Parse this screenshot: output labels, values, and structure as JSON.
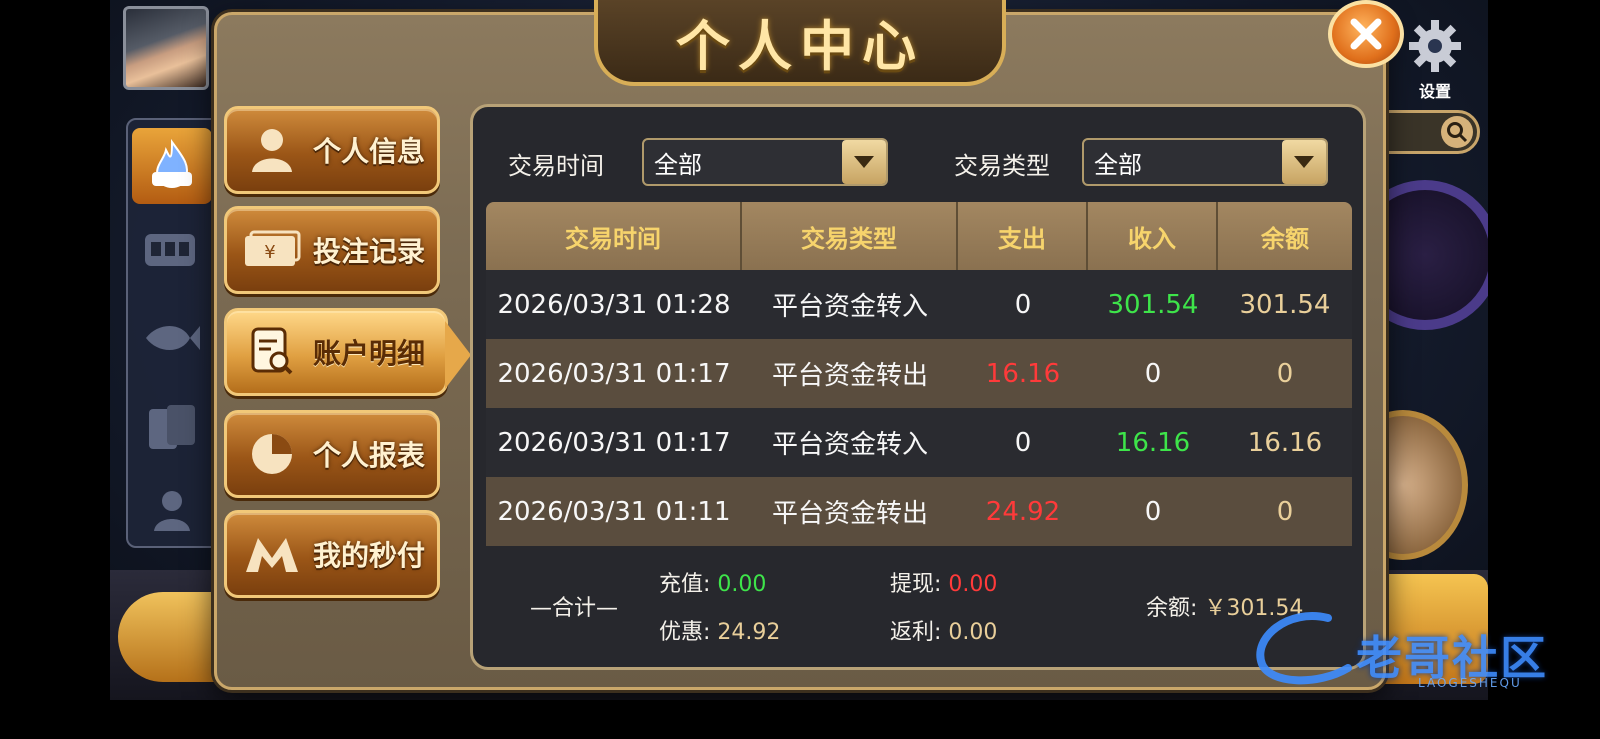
{
  "modal": {
    "title": "个人中心"
  },
  "settings": {
    "label": "设置"
  },
  "nav": [
    {
      "label": "个人信息",
      "icon": "user-icon",
      "active": false
    },
    {
      "label": "投注记录",
      "icon": "money-bill-icon",
      "active": false
    },
    {
      "label": "账户明细",
      "icon": "document-search-icon",
      "active": true
    },
    {
      "label": "个人报表",
      "icon": "pie-chart-icon",
      "active": false
    },
    {
      "label": "我的秒付",
      "icon": "m-logo-icon",
      "active": false
    }
  ],
  "filters": {
    "time_label": "交易时间",
    "time_value": "全部",
    "type_label": "交易类型",
    "type_value": "全部"
  },
  "table": {
    "headers": [
      "交易时间",
      "交易类型",
      "支出",
      "收入",
      "余额"
    ],
    "rows": [
      [
        "2026/03/31 01:28",
        "平台资金转入",
        "0",
        "301.54",
        "301.54"
      ],
      [
        "2026/03/31 01:17",
        "平台资金转出",
        "16.16",
        "0",
        "0"
      ],
      [
        "2026/03/31 01:17",
        "平台资金转入",
        "0",
        "16.16",
        "16.16"
      ],
      [
        "2026/03/31 01:11",
        "平台资金转出",
        "24.92",
        "0",
        "0"
      ]
    ]
  },
  "summary": {
    "total_label": "—合计—",
    "recharge_label": "充值:",
    "recharge_value": "0.00",
    "withdraw_label": "提现:",
    "withdraw_value": "0.00",
    "discount_label": "优惠:",
    "discount_value": "24.92",
    "rebate_label": "返利:",
    "rebate_value": "0.00",
    "balance_label": "余额:",
    "balance_value": "￥301.54"
  },
  "watermark": {
    "text": "老哥社区",
    "sub": "LAOGESHEQU"
  },
  "colors": {
    "income": "#3ee44a",
    "expense": "#ff3a3a",
    "accent_gold": "#f7d46c"
  }
}
